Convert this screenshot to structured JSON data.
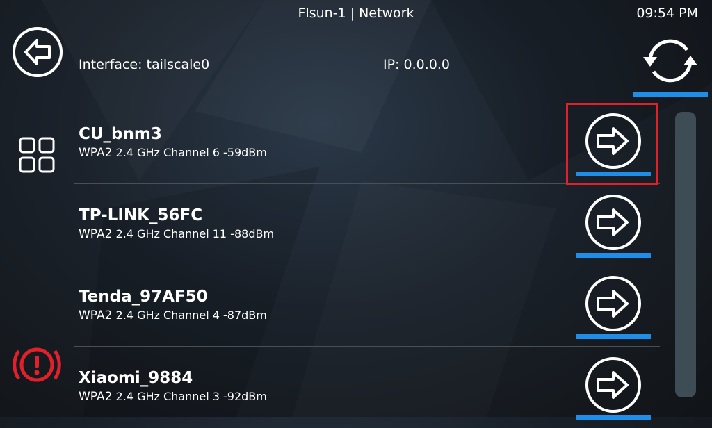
{
  "header": {
    "title": "Flsun-1 | Network",
    "clock": "09:54 PM"
  },
  "info": {
    "interface": "Interface: tailscale0",
    "ip": "IP: 0.0.0.0"
  },
  "colors": {
    "accent": "#1f8ee8",
    "alert": "#e0202a",
    "highlight": "#e0202a"
  },
  "icons": {
    "back": "back-arrow-icon",
    "menu": "grid-menu-icon",
    "alert": "alert-icon",
    "refresh": "refresh-icon",
    "connect": "arrow-right-circle-icon"
  },
  "networks": [
    {
      "ssid": "CU_bnm3",
      "encryption": "WPA2",
      "info": "2.4 GHz Channel 6  -59dBm"
    },
    {
      "ssid": "TP-LINK_56FC",
      "encryption": "WPA2",
      "info": "2.4 GHz Channel 11  -88dBm"
    },
    {
      "ssid": "Tenda_97AF50",
      "encryption": "WPA2",
      "info": "2.4 GHz Channel 4  -87dBm"
    },
    {
      "ssid": "Xiaomi_9884",
      "encryption": "WPA2",
      "info": "2.4 GHz Channel 3  -92dBm"
    }
  ]
}
